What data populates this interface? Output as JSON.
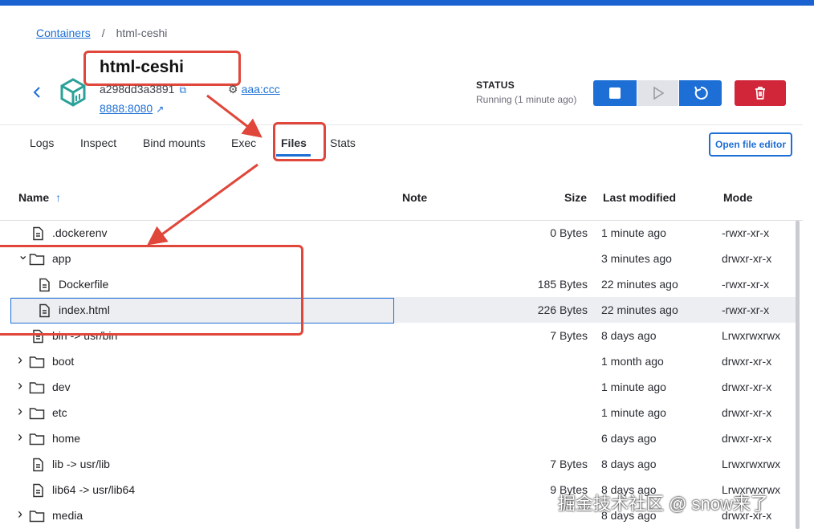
{
  "breadcrumb": {
    "root": "Containers",
    "separator": "/",
    "current": "html-ceshi"
  },
  "container": {
    "name": "html-ceshi",
    "id": "a298dd3a3891",
    "image": "aaa:ccc",
    "port": "8888:8080"
  },
  "status": {
    "label": "STATUS",
    "text": "Running (1 minute ago)"
  },
  "tabs": [
    "Logs",
    "Inspect",
    "Bind mounts",
    "Exec",
    "Files",
    "Stats"
  ],
  "active_tab": "Files",
  "open_editor_label": "Open file editor",
  "table": {
    "headers": {
      "name": "Name",
      "note": "Note",
      "size": "Size",
      "modified": "Last modified",
      "mode": "Mode"
    },
    "rows": [
      {
        "name": ".dockerenv",
        "type": "file",
        "size": "0 Bytes",
        "modified": "1 minute ago",
        "mode": "-rwxr-xr-x"
      },
      {
        "name": "app",
        "type": "folder-open",
        "size": "",
        "modified": "3 minutes ago",
        "mode": "drwxr-xr-x"
      },
      {
        "name": "Dockerfile",
        "type": "file",
        "size": "185 Bytes",
        "modified": "22 minutes ago",
        "mode": "-rwxr-xr-x"
      },
      {
        "name": "index.html",
        "type": "file",
        "size": "226 Bytes",
        "modified": "22 minutes ago",
        "mode": "-rwxr-xr-x"
      },
      {
        "name": "bin -> usr/bin",
        "type": "file",
        "size": "7 Bytes",
        "modified": "8 days ago",
        "mode": "Lrwxrwxrwx"
      },
      {
        "name": "boot",
        "type": "folder",
        "size": "",
        "modified": "1 month ago",
        "mode": "drwxr-xr-x"
      },
      {
        "name": "dev",
        "type": "folder",
        "size": "",
        "modified": "1 minute ago",
        "mode": "drwxr-xr-x"
      },
      {
        "name": "etc",
        "type": "folder",
        "size": "",
        "modified": "1 minute ago",
        "mode": "drwxr-xr-x"
      },
      {
        "name": "home",
        "type": "folder",
        "size": "",
        "modified": "6 days ago",
        "mode": "drwxr-xr-x"
      },
      {
        "name": "lib -> usr/lib",
        "type": "file",
        "size": "7 Bytes",
        "modified": "8 days ago",
        "mode": "Lrwxrwxrwx"
      },
      {
        "name": "lib64 -> usr/lib64",
        "type": "file",
        "size": "9 Bytes",
        "modified": "8 days ago",
        "mode": "Lrwxrwxrwx"
      },
      {
        "name": "media",
        "type": "folder",
        "size": "",
        "modified": "8 days ago",
        "mode": "drwxr-xr-x"
      }
    ]
  },
  "watermark": "掘金技术社区 @ snow来了",
  "colors": {
    "accent": "#1d6fd6",
    "danger": "#d1253a",
    "annotation": "#e0463a",
    "container_icon": "#2aa198"
  }
}
